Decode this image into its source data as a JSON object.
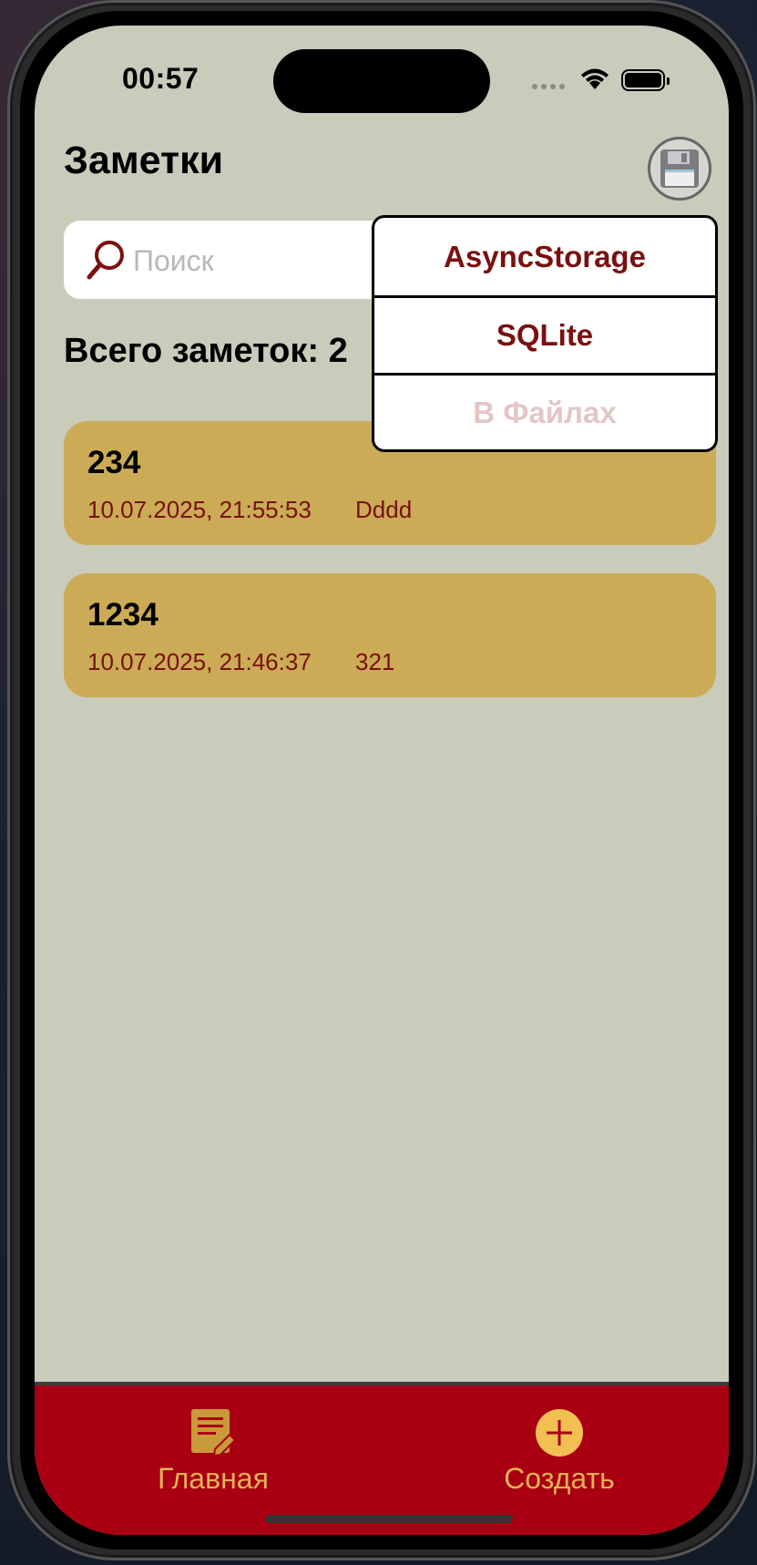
{
  "status_bar": {
    "time": "00:57"
  },
  "header": {
    "title": "Заметки"
  },
  "search": {
    "placeholder": "Поиск",
    "value": ""
  },
  "summary": {
    "count_text": "Всего заметок: 2"
  },
  "notes": [
    {
      "title": "234",
      "date": "10.07.2025, 21:55:53",
      "text": "Dddd"
    },
    {
      "title": "1234",
      "date": "10.07.2025, 21:46:37",
      "text": "321"
    }
  ],
  "storage_menu": {
    "items": [
      {
        "label": "AsyncStorage",
        "enabled": true
      },
      {
        "label": "SQLite",
        "enabled": true
      },
      {
        "label": "В Файлах",
        "enabled": false
      }
    ]
  },
  "tabbar": {
    "home_label": "Главная",
    "create_label": "Создать"
  },
  "colors": {
    "background": "#c9cbbb",
    "note_card": "#cbab56",
    "accent_dark_red": "#7a1010",
    "tabbar": "#a80012",
    "tab_label": "#e3b255"
  },
  "icons": {
    "storage": "floppy-disk-icon",
    "search": "search-icon",
    "home": "note-edit-icon",
    "create": "plus-circle-icon"
  }
}
